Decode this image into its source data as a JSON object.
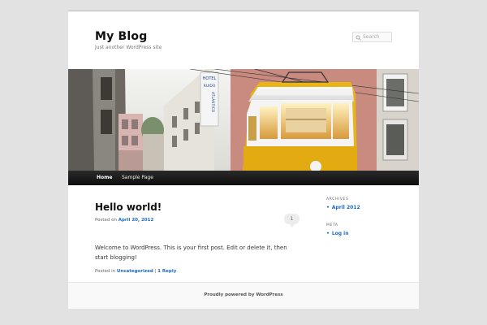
{
  "site": {
    "title": "My Blog",
    "description": "Just another WordPress site",
    "search_placeholder": "Search"
  },
  "banner": {
    "sign_hotel": "HOTEL",
    "sign_rua": "RUIDO",
    "sign_name": "ATLANTICO",
    "colors": {
      "tram_yellow": "#e8b418",
      "building_pink": "#c98a80"
    }
  },
  "nav": {
    "items": [
      {
        "label": "Home",
        "active": true
      },
      {
        "label": "Sample Page",
        "active": false
      }
    ]
  },
  "post": {
    "title": "Hello world!",
    "posted_on_label": "Posted on",
    "date": "April 20, 2012",
    "comment_count": "1",
    "body": "Welcome to WordPress. This is your first post. Edit or delete it, then start blogging!",
    "posted_in_label": "Posted in",
    "category": "Uncategorized",
    "separator": "|",
    "reply_link": "1 Reply"
  },
  "sidebar": {
    "archives_title": "ARCHIVES",
    "archives_item": "April 2012",
    "meta_title": "META",
    "meta_item": "Log in"
  },
  "footer": {
    "text": "Proudly powered by WordPress"
  },
  "colors": {
    "link": "#1b6ac9",
    "nav_bg": "#1a1a1a",
    "page_bg": "#e2e2e2"
  }
}
